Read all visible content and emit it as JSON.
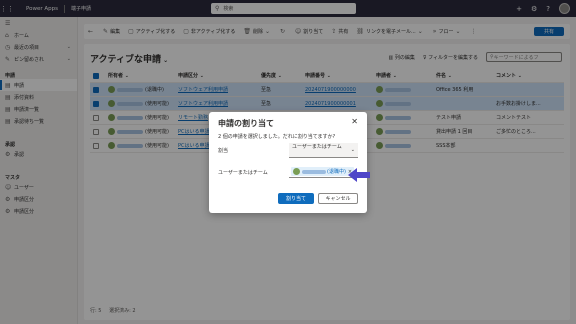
{
  "topbar": {
    "app_name": "Power Apps",
    "sub_app": "端子申請",
    "search_placeholder": "検索"
  },
  "sidebar": {
    "items_top": [
      {
        "label": "ホーム",
        "icon": "home-icon"
      },
      {
        "label": "最近の項目",
        "icon": "clock-icon",
        "chevron": true
      },
      {
        "label": "ピン留めされ",
        "icon": "pin-icon",
        "chevron": true
      }
    ],
    "groups": [
      {
        "title": "申請",
        "items": [
          {
            "label": "申請",
            "icon": "list-icon",
            "active": true
          },
          {
            "label": "添付資料",
            "icon": "list-icon"
          },
          {
            "label": "申請済一覧",
            "icon": "list-icon"
          },
          {
            "label": "承認待ち一覧",
            "icon": "list-icon"
          }
        ]
      },
      {
        "title": "承認",
        "items": [
          {
            "label": "承認",
            "icon": "settings-icon"
          }
        ]
      },
      {
        "title": "マスタ",
        "items": [
          {
            "label": "ユーザー",
            "icon": "user-icon"
          },
          {
            "label": "申請区分",
            "icon": "settings-icon"
          },
          {
            "label": "申請区分",
            "icon": "settings-icon"
          }
        ]
      }
    ]
  },
  "cmdbar": {
    "items": [
      {
        "label": "",
        "icon": "back-arrow-icon"
      },
      {
        "label": "編集",
        "icon": "edit-icon"
      },
      {
        "label": "アクティブ化する",
        "icon": "page-icon"
      },
      {
        "label": "非アクティブ化する",
        "icon": "page-icon"
      },
      {
        "label": "削除",
        "icon": "trash-icon"
      },
      {
        "label": "",
        "icon": "refresh-icon"
      },
      {
        "label": "割り当て",
        "icon": "person-icon"
      },
      {
        "label": "共有",
        "icon": "share-icon"
      },
      {
        "label": "リンクを電子メール...",
        "icon": "link-icon"
      },
      {
        "label": "フロー",
        "icon": "flow-icon"
      }
    ],
    "share_button": "共有"
  },
  "view": {
    "title": "アクティブな申請",
    "edit_columns": "列の編集",
    "edit_filter": "フィルターを編集する",
    "keyword_placeholder": "キーワードによるフ"
  },
  "grid": {
    "columns": [
      "所有者",
      "申請区分",
      "優先度",
      "申請番号",
      "申請者",
      "件名",
      "コメント"
    ],
    "rows": [
      {
        "selected": true,
        "owner_tag": "(退職中)",
        "category": "ソフトウェア利用申請",
        "priority": "至急",
        "number": "2024071900000000",
        "subject": "Office 365 利用",
        "comment": ""
      },
      {
        "selected": true,
        "owner_tag": "(使用可能)",
        "category": "ソフトウェア利用申請",
        "priority": "至急",
        "number": "2024071900000001",
        "subject": "",
        "comment": "お手数お掛けしま..."
      },
      {
        "selected": false,
        "owner_tag": "(使用可能)",
        "category": "リモート勤務",
        "priority": "",
        "number": "",
        "subject": "テスト申請",
        "comment": "コメントテスト"
      },
      {
        "selected": false,
        "owner_tag": "(使用可能)",
        "category": "PCはいる申請",
        "priority": "",
        "number": "",
        "subject": "貸出申請 1 回目",
        "comment": "ご多忙のところ..."
      },
      {
        "selected": false,
        "owner_tag": "(使用可能)",
        "category": "PCはいる申請",
        "priority": "",
        "number": "",
        "subject": "SSS本部",
        "comment": ""
      }
    ]
  },
  "footer": {
    "rows_label": "行: 5",
    "selected_label": "選択済み: 2"
  },
  "dialog": {
    "title": "申請の割り当て",
    "description": "2 個の申請を選択しました。だれに割り当てますか?",
    "assign_label": "割当",
    "assign_value": "ユーザーまたはチーム",
    "user_label": "ユーザーまたはチーム",
    "chip_tag": "(退職中)",
    "assign_button": "割り当て",
    "cancel_button": "キャンセル"
  },
  "colors": {
    "accent": "#0f6cbd",
    "topbar": "#2b2a3d",
    "arrow": "#4f46c8"
  }
}
